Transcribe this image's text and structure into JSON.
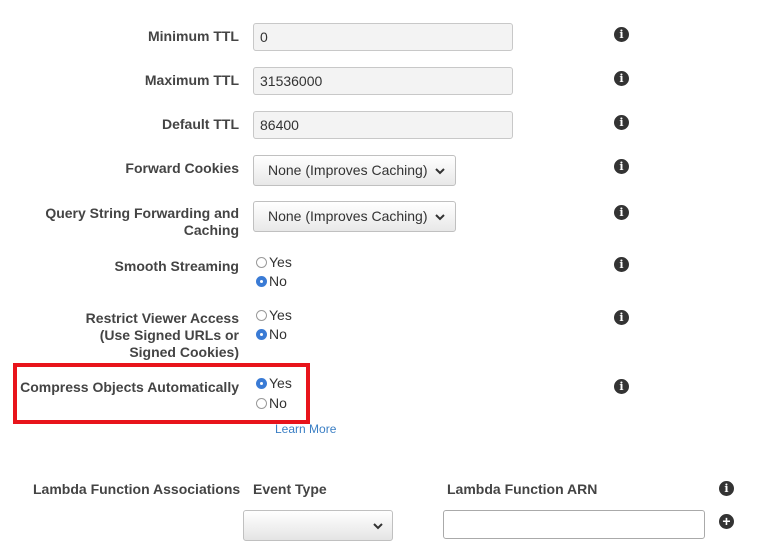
{
  "fields": {
    "min_ttl": {
      "label": "Minimum TTL",
      "value": "0"
    },
    "max_ttl": {
      "label": "Maximum TTL",
      "value": "31536000"
    },
    "default_ttl": {
      "label": "Default TTL",
      "value": "86400"
    },
    "forward_cookies": {
      "label": "Forward Cookies",
      "selected": "None (Improves Caching)"
    },
    "query_string": {
      "label_line1": "Query String Forwarding and",
      "label_line2": "Caching",
      "selected": "None (Improves Caching)"
    },
    "smooth_streaming": {
      "label": "Smooth Streaming",
      "yes": "Yes",
      "no": "No",
      "value": "No"
    },
    "restrict_viewer": {
      "label_line1": "Restrict Viewer Access",
      "label_line2": "(Use Signed URLs or",
      "label_line3": "Signed Cookies)",
      "yes": "Yes",
      "no": "No",
      "value": "No"
    },
    "compress": {
      "label": "Compress Objects Automatically",
      "yes": "Yes",
      "no": "No",
      "value": "Yes",
      "learn_more": "Learn More"
    }
  },
  "lambda": {
    "label": "Lambda Function Associations",
    "event_type_header": "Event Type",
    "arn_header": "Lambda Function ARN",
    "event_type_value": "",
    "arn_value": ""
  },
  "icons": {
    "info": "info-icon",
    "add": "plus-circle-icon"
  },
  "colors": {
    "highlight": "#e8141b",
    "link": "#3b7fc4",
    "radio_selected": "#3a7bd5"
  }
}
